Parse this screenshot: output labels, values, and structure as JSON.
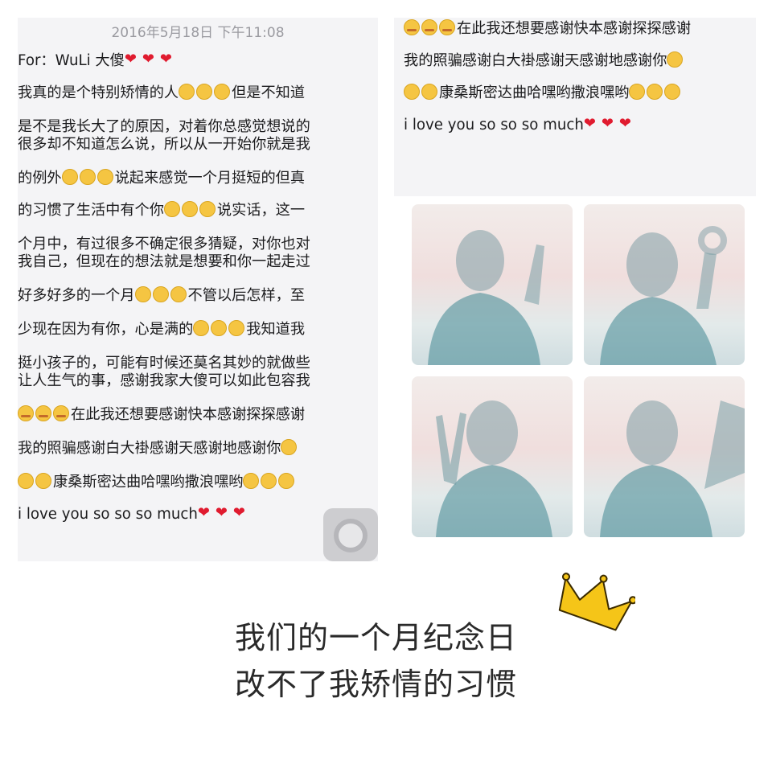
{
  "left_panel": {
    "timestamp": "2016年5月18日 下午11:08",
    "lines": [
      {
        "segs": [
          {
            "t": "For：WuLi 大傻"
          }
        ],
        "emoji": [
          "heart-eyes-emoji",
          "heart-eyes-emoji",
          "heart-eyes-emoji"
        ],
        "after": ""
      },
      {
        "segs": [
          {
            "t": "我真的是个特别矫情的人"
          }
        ],
        "emoji": [
          "flushed-emoji",
          "flushed-emoji",
          "flushed-emoji"
        ],
        "after": "但是不知道"
      },
      {
        "segs": [
          {
            "t": "是不是我长大了的原因，对着你总感觉想说的"
          }
        ],
        "emoji": [],
        "after": ""
      },
      {
        "segs": [
          {
            "t": "很多却不知道怎么说，所以从一开始你就是我"
          }
        ],
        "emoji": [],
        "after": ""
      },
      {
        "segs": [
          {
            "t": "的例外"
          }
        ],
        "emoji": [
          "grimace-emoji",
          "grimace-emoji",
          "grimace-emoji"
        ],
        "after": "说起来感觉一个月挺短的但真"
      },
      {
        "segs": [
          {
            "t": "的习惯了生活中有个你"
          }
        ],
        "emoji": [
          "relieved-emoji",
          "relieved-emoji",
          "relieved-emoji"
        ],
        "after": "说实话，这一"
      },
      {
        "segs": [
          {
            "t": "个月中，有过很多不确定很多猜疑，对你也对"
          }
        ],
        "emoji": [],
        "after": ""
      },
      {
        "segs": [
          {
            "t": "我自己，但现在的想法就是想要和你一起走过"
          }
        ],
        "emoji": [],
        "after": ""
      },
      {
        "segs": [
          {
            "t": "好多好多的一个月"
          }
        ],
        "emoji": [
          "tongue-emoji",
          "tongue-emoji",
          "tongue-emoji"
        ],
        "after": "不管以后怎样，至"
      },
      {
        "segs": [
          {
            "t": "少现在因为有你，心是满的"
          }
        ],
        "emoji": [
          "kiss-emoji",
          "kiss-emoji",
          "kiss-emoji"
        ],
        "after": "我知道我"
      },
      {
        "segs": [
          {
            "t": "挺小孩子的，可能有时候还莫名其妙的就做些"
          }
        ],
        "emoji": [],
        "after": ""
      },
      {
        "segs": [
          {
            "t": "让人生气的事，感谢我家大傻可以如此包容我"
          }
        ],
        "emoji": [],
        "after": ""
      },
      {
        "segs": [
          {
            "t": ""
          }
        ],
        "emoji": [
          "blush-emoji",
          "blush-emoji",
          "blush-emoji"
        ],
        "after": "在此我还想要感谢快本感谢探探感谢"
      },
      {
        "segs": [
          {
            "t": "我的照骗感谢白大褂感谢天感谢地感谢你"
          }
        ],
        "emoji": [
          "joy-emoji"
        ],
        "after": ""
      },
      {
        "segs": [
          {
            "t": ""
          }
        ],
        "emoji": [
          "joy-emoji",
          "joy-emoji"
        ],
        "after": "康桑斯密达曲哈嘿哟撒浪嘿哟"
      },
      {
        "segs": [
          {
            "t": ""
          }
        ],
        "emoji": [],
        "after": "i love you so so so much"
      }
    ],
    "line14_tail": [
      "nerd-emoji",
      "nerd-emoji",
      "nerd-emoji"
    ],
    "line15_tail": [
      "red-heart-emoji",
      "red-heart-emoji",
      "red-heart-emoji"
    ]
  },
  "right_panel": {
    "line1_emoji": [
      "blush-emoji",
      "blush-emoji",
      "blush-emoji"
    ],
    "line1_text": "在此我还想要感谢快本感谢探探感谢",
    "line2_text": "我的照骗感谢白大褂感谢天感谢地感谢你",
    "line2_emoji": [
      "joy-emoji"
    ],
    "line3_emoji": [
      "joy-emoji",
      "joy-emoji"
    ],
    "line3_text": "康桑斯密达曲哈嘿哟撒浪嘿哟",
    "line3_tail": [
      "nerd-emoji",
      "nerd-emoji",
      "nerd-emoji"
    ],
    "line4_text": "i love you so so so much",
    "line4_tail": [
      "red-heart-emoji",
      "red-heart-emoji",
      "red-heart-emoji"
    ],
    "photos": [
      "shadow-selfie-pointing",
      "shadow-selfie-ok-sign",
      "shadow-selfie-peace-sign",
      "shadow-selfie-wave"
    ]
  },
  "caption": {
    "line1": "我们的一个月纪念日",
    "line2": "改不了我矫情的习惯",
    "icon": "crown-icon"
  },
  "colors": {
    "crown": "#f5c518",
    "heart": "#e01b2f",
    "emoji": "#f5c542"
  }
}
